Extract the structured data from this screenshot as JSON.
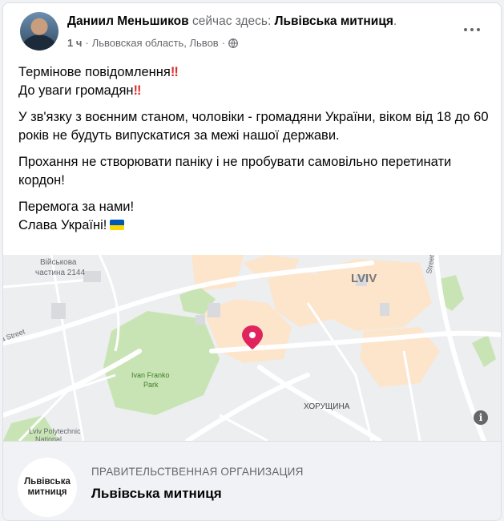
{
  "post": {
    "author": "Даниил Меньшиков",
    "status_prefix": "сейчас здесь:",
    "location_link": "Львівська митниця",
    "location_suffix": ".",
    "time": "1 ч",
    "dot": "·",
    "place": "Львовская область, Львов",
    "privacy_icon": "globe-icon",
    "more_icon": "more-options-icon"
  },
  "content": {
    "line1": "Термінове повідомлення",
    "line2": "До уваги громадян",
    "bang": "‼",
    "para2": "У зв'язку з воєнним станом, чоловіки  - громадяни України, віком від 18 до 60 років не будуть випускатися за межі нашої держави.",
    "para3": "Прохання не створювати паніку і не пробувати самовільно перетинати кордон!",
    "line_victory": "Перемога за нами!",
    "line_glory": "Слава Україні!",
    "flag_colors": [
      "#0057b7",
      "#ffd700"
    ]
  },
  "map": {
    "labels": {
      "military": "Військова",
      "military2": "частина 2144",
      "city": "LVIV",
      "street_left": "a Street",
      "street_right": "Street",
      "park": "Ivan Franko",
      "park2": "Park",
      "district": "ХОРУЩИНА",
      "poly": "Lviv Polytechnic",
      "poly2": "National"
    },
    "pin_color": "#e0245e",
    "info_label": "i"
  },
  "footer": {
    "logo_line1": "Львівська",
    "logo_line2": "митниця",
    "category": "ПРАВИТЕЛЬСТВЕННАЯ ОРГАНИЗАЦИЯ",
    "name": "Львівська митниця"
  }
}
